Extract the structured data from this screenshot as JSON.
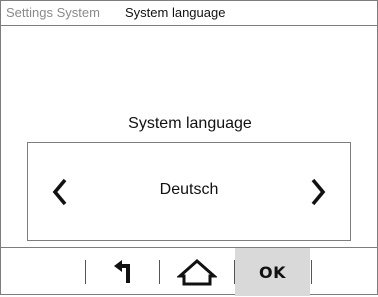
{
  "breadcrumb": {
    "parent": "Settings System",
    "current": "System language"
  },
  "setting": {
    "title": "System language",
    "value": "Deutsch"
  },
  "controls": {
    "prev_icon": "chevron-left-icon",
    "next_icon": "chevron-right-icon"
  },
  "bottom_bar": {
    "back_icon": "back-arrow-icon",
    "home_icon": "home-icon",
    "ok_label": "OK",
    "ok_background": "#d9d9d9"
  }
}
